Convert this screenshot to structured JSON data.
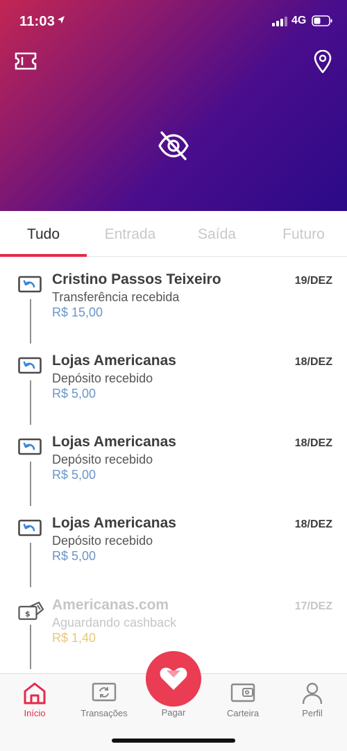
{
  "status_bar": {
    "time": "11:03",
    "network": "4G"
  },
  "header": {
    "icons": {
      "left": "ticket-icon",
      "right": "location-pin-icon",
      "center": "eye-off-icon"
    },
    "colors": {
      "gradient_start": "#c22653",
      "gradient_end": "#2a0a88"
    }
  },
  "tabs": [
    {
      "label": "Tudo",
      "active": true
    },
    {
      "label": "Entrada",
      "active": false
    },
    {
      "label": "Saída",
      "active": false
    },
    {
      "label": "Futuro",
      "active": false
    }
  ],
  "transactions": [
    {
      "name": "Cristino Passos Teixeiro",
      "description": "Transferência recebida",
      "amount": "R$ 15,00",
      "date": "19/DEZ",
      "icon": "incoming-transfer-icon"
    },
    {
      "name": "Lojas Americanas",
      "description": "Depósito recebido",
      "amount": "R$ 5,00",
      "date": "18/DEZ",
      "icon": "incoming-transfer-icon"
    },
    {
      "name": "Lojas Americanas",
      "description": "Depósito recebido",
      "amount": "R$ 5,00",
      "date": "18/DEZ",
      "icon": "incoming-transfer-icon"
    },
    {
      "name": "Lojas Americanas",
      "description": "Depósito recebido",
      "amount": "R$ 5,00",
      "date": "18/DEZ",
      "icon": "incoming-transfer-icon"
    },
    {
      "name": "Americanas.com",
      "description": "Aguardando cashback",
      "amount": "R$ 1,40",
      "date": "17/DEZ",
      "icon": "cashback-icon"
    }
  ],
  "bottom_nav": {
    "items": [
      {
        "label": "Início",
        "icon": "home-icon",
        "active": true
      },
      {
        "label": "Transações",
        "icon": "transactions-icon",
        "active": false
      },
      {
        "label": "Pagar",
        "icon": "heart-pay-icon",
        "active": false
      },
      {
        "label": "Carteira",
        "icon": "wallet-icon",
        "active": false
      },
      {
        "label": "Perfil",
        "icon": "user-icon",
        "active": false
      }
    ]
  },
  "colors": {
    "accent": "#e8284a",
    "amount": "#6b95c8",
    "cashback_amount": "#e8c87a"
  }
}
